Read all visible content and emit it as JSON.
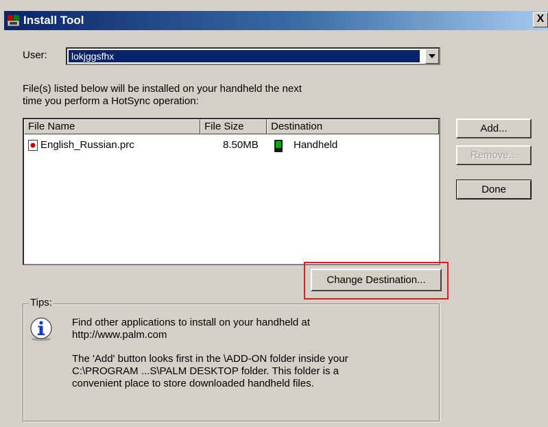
{
  "window": {
    "title": "Install Tool",
    "close_label": "X"
  },
  "user": {
    "label": "User:",
    "selected": "lokjggsfhx"
  },
  "instructions": {
    "line1": "File(s) listed below will be installed on your handheld the next",
    "line2": "time you perform a HotSync operation:"
  },
  "file_list": {
    "columns": [
      "File Name",
      "File Size",
      "Destination"
    ],
    "rows": [
      {
        "name": "English_Russian.prc",
        "size": "8.50MB",
        "destination": "Handheld"
      }
    ]
  },
  "buttons": {
    "add": "Add...",
    "remove": "Remove...",
    "done": "Done",
    "change_destination": "Change Destination..."
  },
  "tips": {
    "legend": "Tips:",
    "p1_line1": "Find other applications to install on your handheld at",
    "p1_line2": "http://www.palm.com",
    "p2_line1": "The 'Add' button looks first in the \\ADD-ON folder inside your",
    "p2_line2": "C:\\PROGRAM ...S\\PALM DESKTOP folder. This folder is a",
    "p2_line3": "convenient place to store downloaded handheld files."
  },
  "colors": {
    "titlebar": "#0a246a",
    "selection": "#0a246a",
    "highlight_box": "#e8161d",
    "dialog_bg": "#d4d0c8"
  }
}
